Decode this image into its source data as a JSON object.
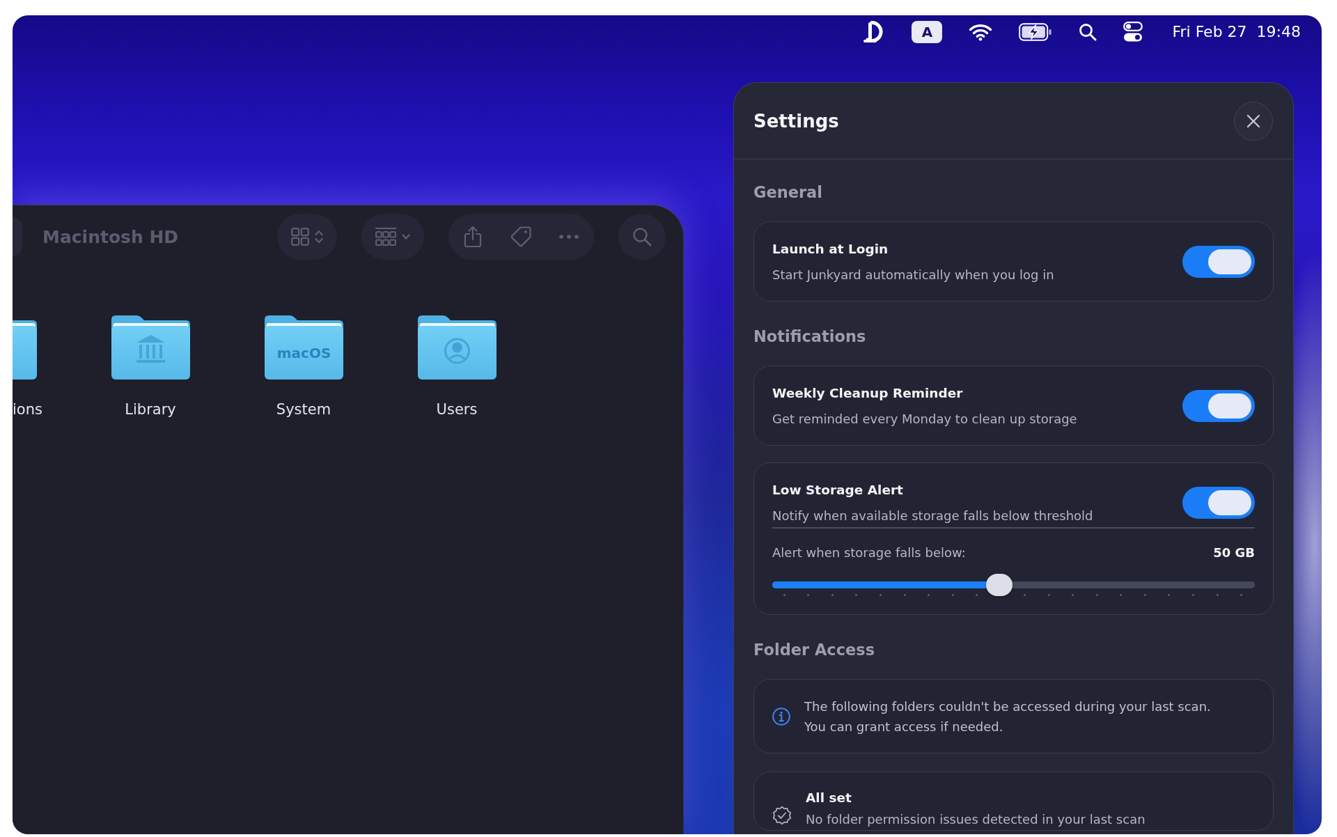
{
  "menu_bar": {
    "input_source": "A",
    "date": "Fri Feb 27",
    "time": "19:48"
  },
  "finder": {
    "title": "Macintosh HD",
    "items": [
      {
        "label": "ions",
        "kind": "partial"
      },
      {
        "label": "Library",
        "kind": "columns"
      },
      {
        "label": "System",
        "kind": "emblem",
        "emblem": "macOS"
      },
      {
        "label": "Users",
        "kind": "person"
      }
    ]
  },
  "settings": {
    "title": "Settings",
    "sections": [
      {
        "title": "General",
        "cards": [
          {
            "kind": "toggle",
            "title": "Launch at Login",
            "description": "Start Junkyard automatically when you log in",
            "on": true
          }
        ]
      },
      {
        "title": "Notifications",
        "cards": [
          {
            "kind": "toggle",
            "title": "Weekly Cleanup Reminder",
            "description": "Get reminded every Monday to clean up storage",
            "on": true
          },
          {
            "kind": "toggle",
            "title": "Low Storage Alert",
            "description": "Notify when available storage falls below threshold",
            "on": true,
            "slider": {
              "label": "Alert when storage falls below:",
              "reading": "50 GB",
              "level": 0.47
            }
          }
        ]
      },
      {
        "title": "Folder Access",
        "cards": [
          {
            "kind": "info",
            "text": "The following folders couldn't be accessed during your last scan. You can grant access if needed."
          },
          {
            "kind": "status",
            "title": "All set",
            "description": "No folder permission issues detected in your last scan"
          }
        ]
      }
    ]
  }
}
